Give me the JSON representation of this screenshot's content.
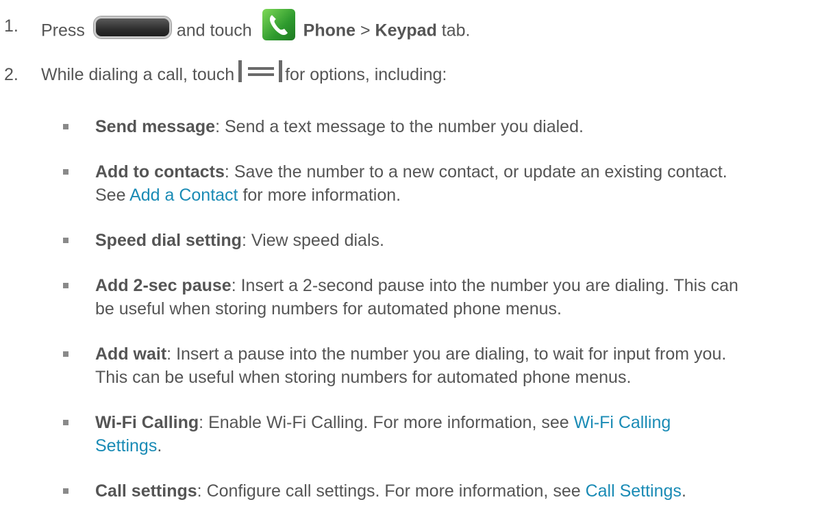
{
  "steps": [
    {
      "number": "1.",
      "text_a": "Press",
      "text_b": "and touch",
      "bold_a": "Phone",
      "sep": " > ",
      "bold_b": "Keypad",
      "text_c": " tab."
    },
    {
      "number": "2.",
      "text_a": "While dialing a call, touch",
      "text_b": "for options, including:"
    }
  ],
  "options": [
    {
      "term": "Send message",
      "sep": ": ",
      "lines": [
        "Send a text message to the number you dialed."
      ]
    },
    {
      "term": "Add to contacts",
      "sep": ": ",
      "line1": "Save the number to a new contact, or update an existing contact.",
      "line2_pre": "See ",
      "link": "Add a Contact",
      "line2_post": " for more information."
    },
    {
      "term": "Speed dial setting",
      "sep": ": ",
      "lines": [
        "View speed dials."
      ]
    },
    {
      "term": "Add 2-sec pause",
      "sep": ": ",
      "lines": [
        "Insert a 2-second pause into the number you are dialing. This can",
        "be useful when storing numbers for automated phone menus."
      ]
    },
    {
      "term": "Add wait",
      "sep": ": ",
      "lines": [
        "Insert a pause into the number you are dialing, to wait for input from you.",
        "This can be useful when storing numbers for automated phone menus."
      ]
    },
    {
      "term": "Wi-Fi Calling",
      "sep": ": ",
      "line1_pre": "Enable Wi-Fi Calling. For more information, see ",
      "link_part1": "Wi-Fi Calling",
      "link_part2": "Settings",
      "line2_post": "."
    },
    {
      "term": "Call settings",
      "sep": ": ",
      "line1_pre": "Configure call settings. For more information, see ",
      "link": "Call Settings",
      "line1_post": "."
    }
  ],
  "icons": {
    "home_button": "home-key-icon",
    "phone": "phone-app-icon",
    "menu": "menu-key-icon"
  },
  "colors": {
    "text": "#555555",
    "link": "#1a8bb5",
    "bullet": "#8a8a8a"
  }
}
